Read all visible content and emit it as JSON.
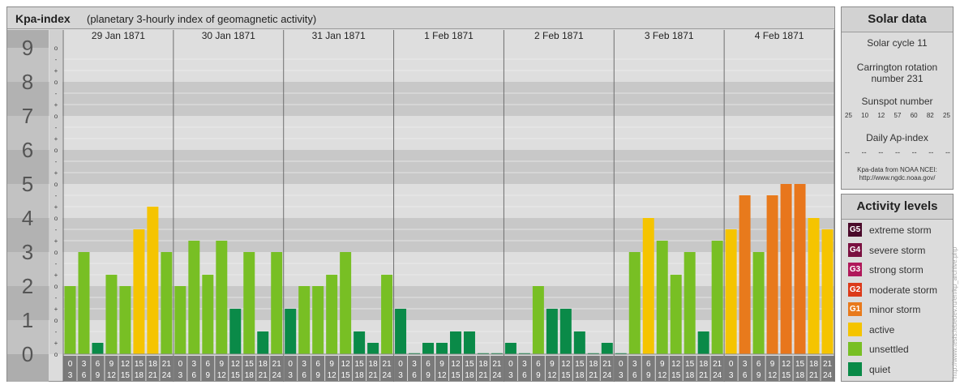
{
  "header": {
    "title": "Kpa-index",
    "subtitle": "(planetary 3-hourly index of geomagnetic activity)"
  },
  "solar": {
    "heading": "Solar data",
    "cycle": "Solar cycle 11",
    "carrington_line1": "Carrington rotation",
    "carrington_line2": "number 231",
    "sunspot_heading": "Sunspot number",
    "sunspot_values": [
      "25",
      "10",
      "12",
      "57",
      "60",
      "82",
      "25"
    ],
    "ap_heading": "Daily Ap-index",
    "ap_values": [
      "--",
      "--",
      "--",
      "--",
      "--",
      "--",
      "--"
    ],
    "credit_line1": "Kpa-data from NOAA NCEI:",
    "credit_line2": "http://www.ngdc.noaa.gov/"
  },
  "levels": {
    "heading": "Activity levels",
    "items": [
      {
        "code": "G5",
        "label": "extreme storm",
        "color": "#4a0a2a"
      },
      {
        "code": "G4",
        "label": "severe storm",
        "color": "#7a1040"
      },
      {
        "code": "G3",
        "label": "strong storm",
        "color": "#b0185a"
      },
      {
        "code": "G2",
        "label": "moderate storm",
        "color": "#dc3a1a"
      },
      {
        "code": "G1",
        "label": "minor storm",
        "color": "#e87a1c"
      },
      {
        "code": "",
        "label": "active",
        "color": "#f5c400"
      },
      {
        "code": "",
        "label": "unsettled",
        "color": "#78bf24"
      },
      {
        "code": "",
        "label": "quiet",
        "color": "#0a8a48"
      }
    ]
  },
  "watermark": "http://www.tesis.lebedev.ru/en/kp_archive.php",
  "chart_data": {
    "type": "bar",
    "ylim": [
      0,
      9
    ],
    "y_major_ticks": [
      "0",
      "1",
      "2",
      "3",
      "4",
      "5",
      "6",
      "7",
      "8",
      "9"
    ],
    "y_minor_ticks": [
      "-",
      "o",
      "+"
    ],
    "days": [
      "29 Jan 1871",
      "30 Jan 1871",
      "31 Jan 1871",
      "1 Feb 1871",
      "2 Feb 1871",
      "3 Feb 1871",
      "4 Feb 1871"
    ],
    "interval_starts": [
      "0",
      "3",
      "6",
      "9",
      "12",
      "15",
      "18",
      "21"
    ],
    "interval_ends": [
      "3",
      "6",
      "9",
      "12",
      "15",
      "18",
      "21",
      "24"
    ],
    "values": [
      [
        2.0,
        3.0,
        0.333,
        2.333,
        2.0,
        3.667,
        4.333,
        3.0
      ],
      [
        2.0,
        3.333,
        2.333,
        3.333,
        1.333,
        3.0,
        0.667,
        3.0
      ],
      [
        1.333,
        2.0,
        2.0,
        2.333,
        3.0,
        0.667,
        0.333,
        2.333
      ],
      [
        1.333,
        0.0,
        0.333,
        0.333,
        0.667,
        0.667,
        0.0,
        0.0
      ],
      [
        0.333,
        0.0,
        2.0,
        1.333,
        1.333,
        0.667,
        0.0,
        0.333
      ],
      [
        0.0,
        3.0,
        4.0,
        3.333,
        2.333,
        3.0,
        0.667,
        3.333
      ],
      [
        3.667,
        4.667,
        3.0,
        4.667,
        5.0,
        5.0,
        4.0,
        3.667
      ]
    ],
    "colors": {
      "quiet": "#0a8a48",
      "unsettled": "#78bf24",
      "active": "#f5c400",
      "minor_storm": "#e87a1c",
      "moderate_storm": "#dc3a1a",
      "background_dark": "#c8c8c8",
      "background_light": "#dedede",
      "axis_band": "#adadad"
    }
  }
}
